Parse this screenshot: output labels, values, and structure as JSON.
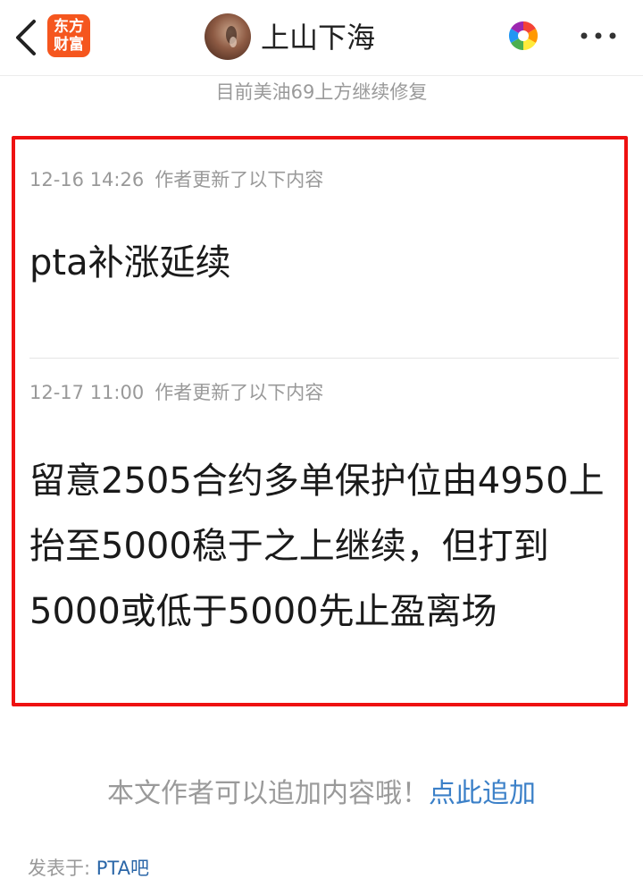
{
  "header": {
    "logo_line1": "东方",
    "logo_line2": "财富",
    "author_name": "上山下海",
    "logo_color": "#f5561e"
  },
  "subtitle": "目前美油69上方继续修复",
  "updates": [
    {
      "time": "12-16 14:26",
      "label": "作者更新了以下内容",
      "content": "pta补涨延续"
    },
    {
      "time": "12-17 11:00",
      "label": "作者更新了以下内容",
      "content": "留意2505合约多单保护位由4950上抬至5000稳于之上继续，但打到5000或低于5000先止盈离场"
    }
  ],
  "footer": {
    "add_tip_text": "本文作者可以追加内容哦！",
    "add_link": "点此追加",
    "posted_label": "发表于:",
    "forum": "PTA吧"
  },
  "colors": {
    "highlight_border": "#ee1111",
    "link": "#3b80c8"
  },
  "icons": [
    "back-arrow-icon",
    "color-wheel-icon",
    "more-dots-icon"
  ]
}
